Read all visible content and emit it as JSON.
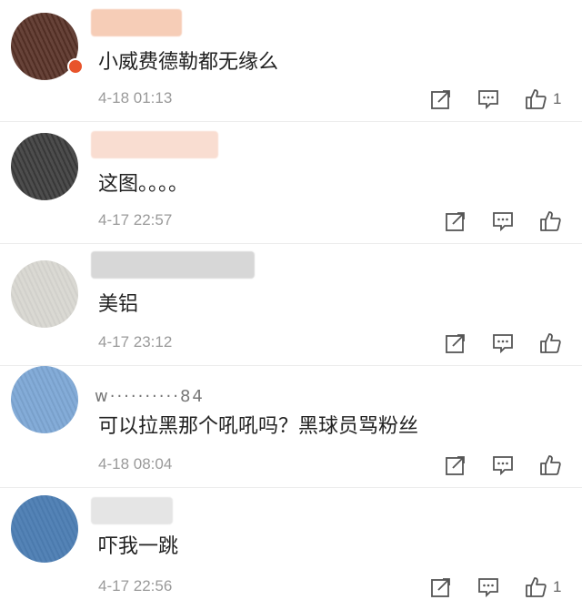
{
  "comments": [
    {
      "name": "",
      "text": "小威费德勒都无缘么",
      "time": "4-18 01:13",
      "likes": "1",
      "avatar_color": "#5a3328",
      "name_color": "#f3b89a"
    },
    {
      "name": "",
      "text": "这图。。。。",
      "time": "4-17 22:57",
      "likes": "",
      "avatar_color": "#3e3e3e",
      "name_color": "#f6c7b3"
    },
    {
      "name": "",
      "text": "美铝",
      "time": "4-17 23:12",
      "likes": "",
      "avatar_color": "#d9d8d2",
      "name_color": "#bdbdbd"
    },
    {
      "name": "w··········84",
      "text": "可以拉黑那个吼吼吗？黑球员骂粉丝",
      "time": "4-18 08:04",
      "likes": "",
      "avatar_color": "#7fa9d6",
      "name_color": "#cfcfcf"
    },
    {
      "name": "",
      "text": "吓我一跳",
      "time": "4-17 22:56",
      "likes": "1",
      "avatar_color": "#4e7fb4",
      "name_color": "#d4d4d4"
    }
  ],
  "icons": {
    "forward": "share-icon",
    "reply": "comment-icon",
    "like": "thumbs-up-icon"
  }
}
